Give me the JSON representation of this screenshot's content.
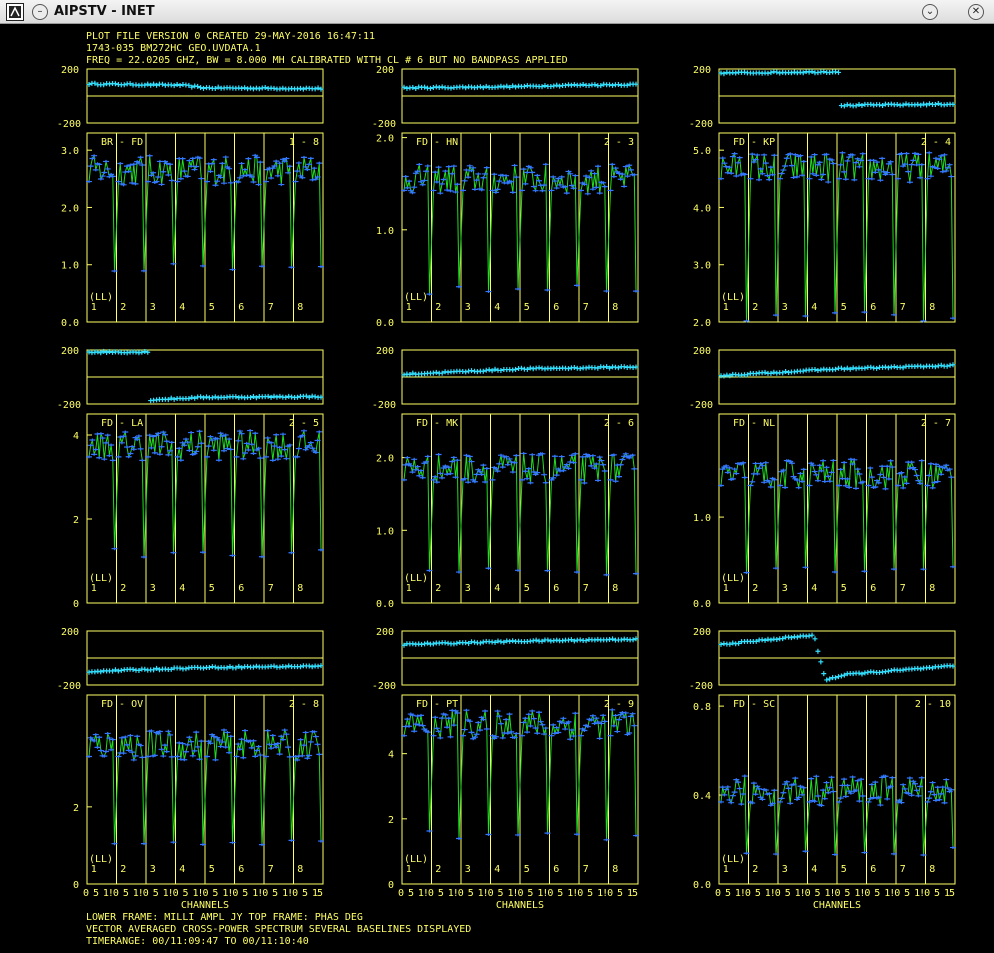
{
  "window": {
    "title": "AIPSTV - INET",
    "icons": {
      "app": "aips-app-icon",
      "collapse": "chevron-down-icon",
      "close": "close-icon"
    },
    "collapse_glyph": "⌄",
    "close_glyph": "✕"
  },
  "colors": {
    "background": "#000000",
    "frame": "#ffff66",
    "amplitude_line": "#22dd22",
    "phase_marks": "#33e0ff",
    "amplitude_marks": "#3377ff"
  },
  "header": {
    "line1": "PLOT FILE VERSION 0  CREATED 29-MAY-2016 16:47:11",
    "line2": "1743-035   BM272HC GEO.UVDATA.1",
    "line3": "FREQ = 22.0205 GHZ, BW = 8.000 MH   CALIBRATED WITH CL # 6 BUT NO BANDPASS APPLIED"
  },
  "footer": {
    "line1": "LOWER FRAME: MILLI AMPL JY   TOP FRAME: PHAS DEG",
    "line2": "VECTOR AVERAGED CROSS-POWER SPECTRUM    SEVERAL BASELINES DISPLAYED",
    "line3": "TIMERANGE: 00/11:09:47 TO 00/11:10:40"
  },
  "chart_data": {
    "type": "line",
    "x_axis_label": "CHANNELS",
    "x_tick_label_pattern": "0 5 1!0 5 1!0 5 1!0 5 1!0 5 1!0 5 1!0 5 1!0 5 15",
    "subband_labels": [
      "1",
      "2",
      "3",
      "4",
      "5",
      "6",
      "7",
      "8"
    ],
    "polarization": "(LL)",
    "phase_ylim": [
      -200,
      200
    ],
    "phase_tick_labels": [
      "200",
      "-200"
    ],
    "panels": [
      {
        "baseline": "BR - FD",
        "numbers": "1 - 8",
        "amp_ylim": [
          0,
          3.3
        ],
        "amp_ticks": [
          "3.0",
          "2.0",
          "1.0",
          "0.0"
        ],
        "amp_tick_values": [
          3,
          2,
          1,
          0
        ],
        "amp_level": 2.65,
        "dip_level": 0.95,
        "phase_segments": [
          [
            0,
            90
          ],
          [
            0.4,
            80
          ],
          [
            0.5,
            60
          ],
          [
            1.0,
            55
          ]
        ]
      },
      {
        "baseline": "FD - HN",
        "numbers": "2 - 3",
        "amp_ylim": [
          0,
          2.05
        ],
        "amp_ticks": [
          "2.0",
          "1.0",
          "0.0"
        ],
        "amp_tick_values": [
          2,
          1,
          0
        ],
        "amp_level": 1.55,
        "dip_level": 0.35,
        "phase_segments": [
          [
            0,
            60
          ],
          [
            0.5,
            70
          ],
          [
            0.7,
            80
          ],
          [
            1.0,
            85
          ]
        ]
      },
      {
        "baseline": "FD - KP",
        "numbers": "2 - 4",
        "amp_ylim": [
          2,
          5.3
        ],
        "amp_ticks": [
          "5.0",
          "4.0",
          "3.0",
          "2.0"
        ],
        "amp_tick_values": [
          5,
          4,
          3,
          2
        ],
        "amp_level": 4.7,
        "dip_level": 2.1,
        "phase_segments": [
          [
            0,
            170
          ],
          [
            0.5,
            180
          ],
          [
            0.51,
            -70
          ],
          [
            1.0,
            -60
          ]
        ]
      },
      {
        "baseline": "FD - LA",
        "numbers": "2 - 5",
        "amp_ylim": [
          0,
          4.5
        ],
        "amp_ticks": [
          "4",
          "2",
          "0"
        ],
        "amp_tick_values": [
          4,
          2,
          0
        ],
        "amp_level": 3.75,
        "dip_level": 1.2,
        "phase_segments": [
          [
            0,
            185
          ],
          [
            0.25,
            185
          ],
          [
            0.26,
            -170
          ],
          [
            0.5,
            -150
          ],
          [
            1.0,
            -145
          ]
        ]
      },
      {
        "baseline": "FD - MK",
        "numbers": "2 - 6",
        "amp_ylim": [
          0,
          2.6
        ],
        "amp_ticks": [
          "2.0",
          "1.0",
          "0.0"
        ],
        "amp_tick_values": [
          2,
          1,
          0
        ],
        "amp_level": 1.85,
        "dip_level": 0.45,
        "phase_segments": [
          [
            0,
            20
          ],
          [
            0.5,
            60
          ],
          [
            1.0,
            75
          ]
        ]
      },
      {
        "baseline": "FD - NL",
        "numbers": "2 - 7",
        "amp_ylim": [
          0,
          2.2
        ],
        "amp_ticks": [
          "1.0",
          "0.0"
        ],
        "amp_tick_values": [
          1,
          0
        ],
        "amp_level": 1.5,
        "dip_level": 0.4,
        "phase_segments": [
          [
            0,
            10
          ],
          [
            0.5,
            60
          ],
          [
            1.0,
            85
          ]
        ]
      },
      {
        "baseline": "FD - OV",
        "numbers": "2 - 8",
        "amp_ylim": [
          0,
          4.9
        ],
        "amp_ticks": [
          "2",
          "0"
        ],
        "amp_tick_values": [
          2,
          0
        ],
        "amp_level": 3.6,
        "dip_level": 1.1,
        "phase_segments": [
          [
            0,
            -100
          ],
          [
            0.5,
            -70
          ],
          [
            1.0,
            -60
          ]
        ]
      },
      {
        "baseline": "FD - PT",
        "numbers": "2 - 9",
        "amp_ylim": [
          0,
          5.8
        ],
        "amp_ticks": [
          "4",
          "2",
          "0"
        ],
        "amp_tick_values": [
          4,
          2,
          0
        ],
        "amp_level": 4.9,
        "dip_level": 1.5,
        "phase_segments": [
          [
            0,
            100
          ],
          [
            0.5,
            125
          ],
          [
            1.0,
            140
          ]
        ]
      },
      {
        "baseline": "FD - SC",
        "numbers": "2 - 10",
        "amp_ylim": [
          0,
          0.85
        ],
        "amp_ticks": [
          "0.8",
          "0.4",
          "0.0"
        ],
        "amp_tick_values": [
          0.8,
          0.4,
          0
        ],
        "amp_level": 0.42,
        "dip_level": 0.15,
        "phase_segments": [
          [
            0,
            100
          ],
          [
            0.4,
            170
          ],
          [
            0.45,
            -160
          ],
          [
            0.55,
            -120
          ],
          [
            1.0,
            -60
          ]
        ]
      }
    ]
  }
}
